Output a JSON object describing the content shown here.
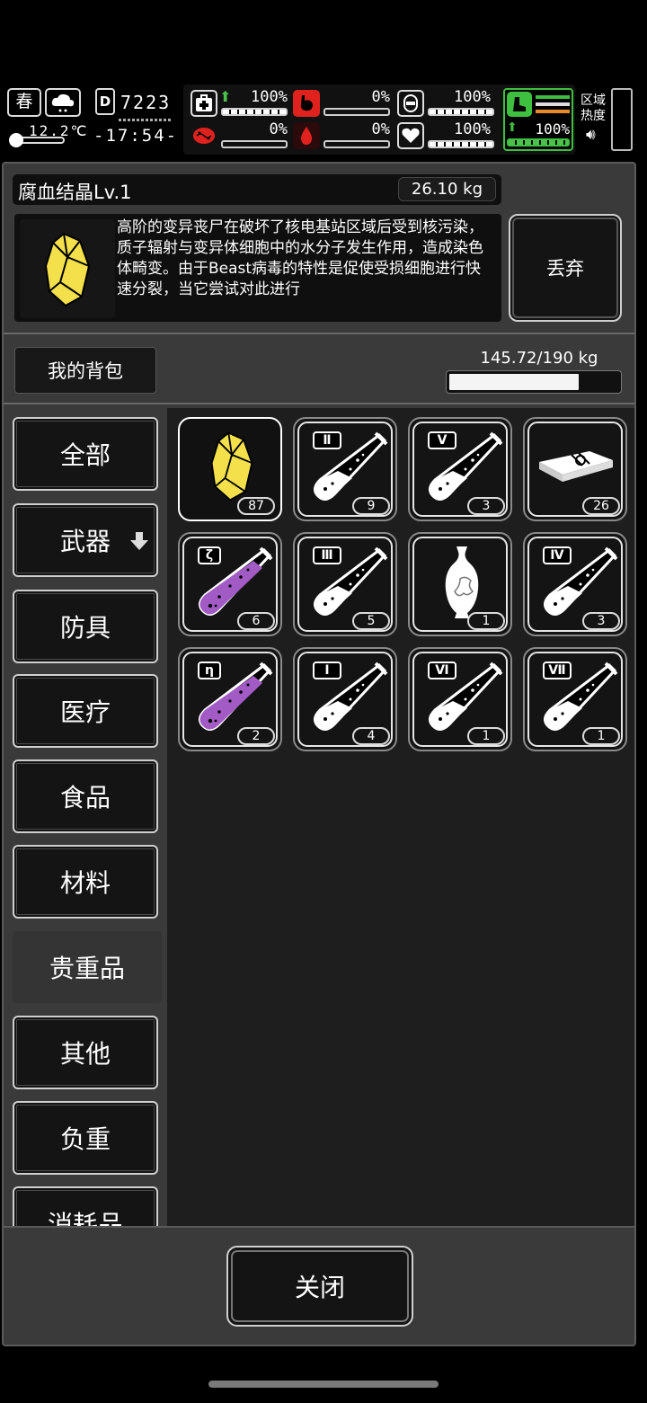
{
  "hud": {
    "season": "春",
    "temperature": "12.2℃",
    "day": "7223",
    "time": "-17:54-",
    "stats": [
      {
        "name": "health",
        "value": "100%",
        "level": 1.0
      },
      {
        "name": "hunger",
        "value": "0%",
        "level": 0.0
      },
      {
        "name": "sanity",
        "value": "100%",
        "level": 1.0
      },
      {
        "name": "infection",
        "value": "0%",
        "level": 0.0
      },
      {
        "name": "bleeding",
        "value": "0%",
        "level": 0.0
      },
      {
        "name": "mood",
        "value": "100%",
        "level": 1.0
      },
      {
        "name": "stamina",
        "value": "100%",
        "level": 1.0
      }
    ],
    "zone_heat_label": "区域热度"
  },
  "item_detail": {
    "title": "腐血结晶Lv.1",
    "weight": "26.10 kg",
    "description": "高阶的变异丧尸在破坏了核电基站区域后受到核污染，质子辐射与变异体细胞中的水分子发生作用，造成染色体畸变。由于Beast病毒的特性是促使受损细胞进行快速分裂，当它尝试对此进行",
    "discard_label": "丢弃"
  },
  "bag": {
    "title": "我的背包",
    "capacity": "145.72/190 kg",
    "capacity_fraction": 0.767
  },
  "categories": [
    {
      "label": "全部",
      "active": false
    },
    {
      "label": "武器",
      "active": false,
      "has_arrow": true
    },
    {
      "label": "防具",
      "active": false
    },
    {
      "label": "医疗",
      "active": false
    },
    {
      "label": "食品",
      "active": false
    },
    {
      "label": "材料",
      "active": false
    },
    {
      "label": "贵重品",
      "active": true
    },
    {
      "label": "其他",
      "active": false
    },
    {
      "label": "负重",
      "active": false
    },
    {
      "label": "消耗品",
      "active": false
    }
  ],
  "items": [
    {
      "icon": "crystal",
      "count": "87",
      "selected": true
    },
    {
      "icon": "test-tube",
      "tag": "Ⅱ",
      "count": "9"
    },
    {
      "icon": "test-tube",
      "tag": "Ⅴ",
      "count": "3"
    },
    {
      "icon": "cash-bundle",
      "count": "26"
    },
    {
      "icon": "test-tube-purple",
      "tag": "ζ",
      "count": "6"
    },
    {
      "icon": "test-tube",
      "tag": "Ⅲ",
      "count": "5"
    },
    {
      "icon": "vase",
      "count": "1"
    },
    {
      "icon": "test-tube",
      "tag": "Ⅳ",
      "count": "3"
    },
    {
      "icon": "test-tube-purple",
      "tag": "η",
      "count": "2"
    },
    {
      "icon": "test-tube",
      "tag": "Ⅰ",
      "count": "4"
    },
    {
      "icon": "test-tube",
      "tag": "Ⅵ",
      "count": "1"
    },
    {
      "icon": "test-tube",
      "tag": "Ⅶ",
      "count": "1"
    }
  ],
  "close_label": "关闭",
  "colors": {
    "crystal": "#f3e04a",
    "purple": "#a25bc4",
    "health_green": "#4cc24c",
    "danger_red": "#e0221e",
    "stamina_green": "#3fbf3f",
    "orange": "#e88a2a"
  }
}
